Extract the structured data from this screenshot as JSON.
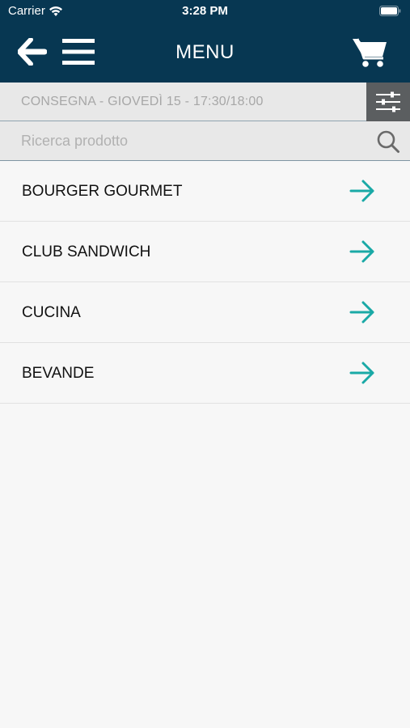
{
  "status_bar": {
    "carrier": "Carrier",
    "time": "3:28 PM"
  },
  "nav": {
    "title": "MENU"
  },
  "delivery": {
    "text": "CONSEGNA - GIOVEDÌ 15 - 17:30/18:00"
  },
  "search": {
    "placeholder": "Ricerca prodotto",
    "value": ""
  },
  "categories": [
    {
      "label": "BOURGER GOURMET"
    },
    {
      "label": "CLUB SANDWICH"
    },
    {
      "label": "CUCINA"
    },
    {
      "label": "BEVANDE"
    }
  ],
  "colors": {
    "header_bg": "#073752",
    "accent_arrow": "#1aa9a6",
    "filter_bg": "#5b5e60",
    "bar_bg": "#e8e8e8",
    "page_bg": "#f7f7f7"
  },
  "icons": {
    "back": "back-arrow-icon",
    "menu": "hamburger-icon",
    "cart": "cart-icon",
    "filter": "sliders-icon",
    "search": "search-icon",
    "row_arrow": "arrow-right-icon"
  }
}
